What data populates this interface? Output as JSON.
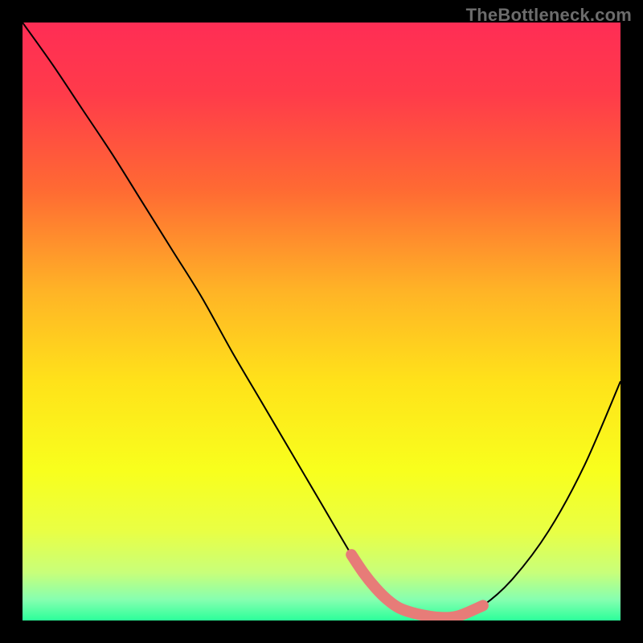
{
  "watermark": {
    "text": "TheBottleneck.com"
  },
  "colors": {
    "black": "#000000",
    "curve": "#000000",
    "marker": "#e77c78",
    "gradient_stops": [
      {
        "offset": 0.0,
        "color": "#ff2d55"
      },
      {
        "offset": 0.12,
        "color": "#ff3b4a"
      },
      {
        "offset": 0.28,
        "color": "#ff6a33"
      },
      {
        "offset": 0.45,
        "color": "#ffb426"
      },
      {
        "offset": 0.6,
        "color": "#ffe21a"
      },
      {
        "offset": 0.75,
        "color": "#f8ff1d"
      },
      {
        "offset": 0.85,
        "color": "#e9ff44"
      },
      {
        "offset": 0.92,
        "color": "#c8ff7a"
      },
      {
        "offset": 0.965,
        "color": "#86ffb0"
      },
      {
        "offset": 1.0,
        "color": "#2bff9a"
      }
    ]
  },
  "chart_data": {
    "type": "line",
    "title": "",
    "xlabel": "",
    "ylabel": "",
    "xlim": [
      0,
      100
    ],
    "ylim": [
      0,
      100
    ],
    "grid": false,
    "legend": false,
    "series": [
      {
        "name": "bottleneck-curve",
        "x": [
          0,
          5,
          10,
          15,
          20,
          25,
          30,
          35,
          40,
          45,
          50,
          55,
          57,
          59,
          61,
          63,
          66,
          70,
          73,
          77,
          82,
          88,
          94,
          100
        ],
        "y": [
          100,
          93,
          85.5,
          78,
          70,
          62,
          54,
          45,
          36.5,
          28,
          19.5,
          11,
          8,
          5.5,
          3.5,
          2.1,
          1.1,
          0.5,
          0.8,
          2.5,
          7,
          15,
          26,
          40
        ]
      }
    ],
    "markers": {
      "name": "highlight-segment",
      "color": "#e77c78",
      "x": [
        55,
        57,
        59,
        61,
        63,
        66,
        70,
        73,
        77
      ],
      "y": [
        11,
        8,
        5.5,
        3.5,
        2.1,
        1.1,
        0.5,
        0.8,
        2.5
      ]
    }
  }
}
